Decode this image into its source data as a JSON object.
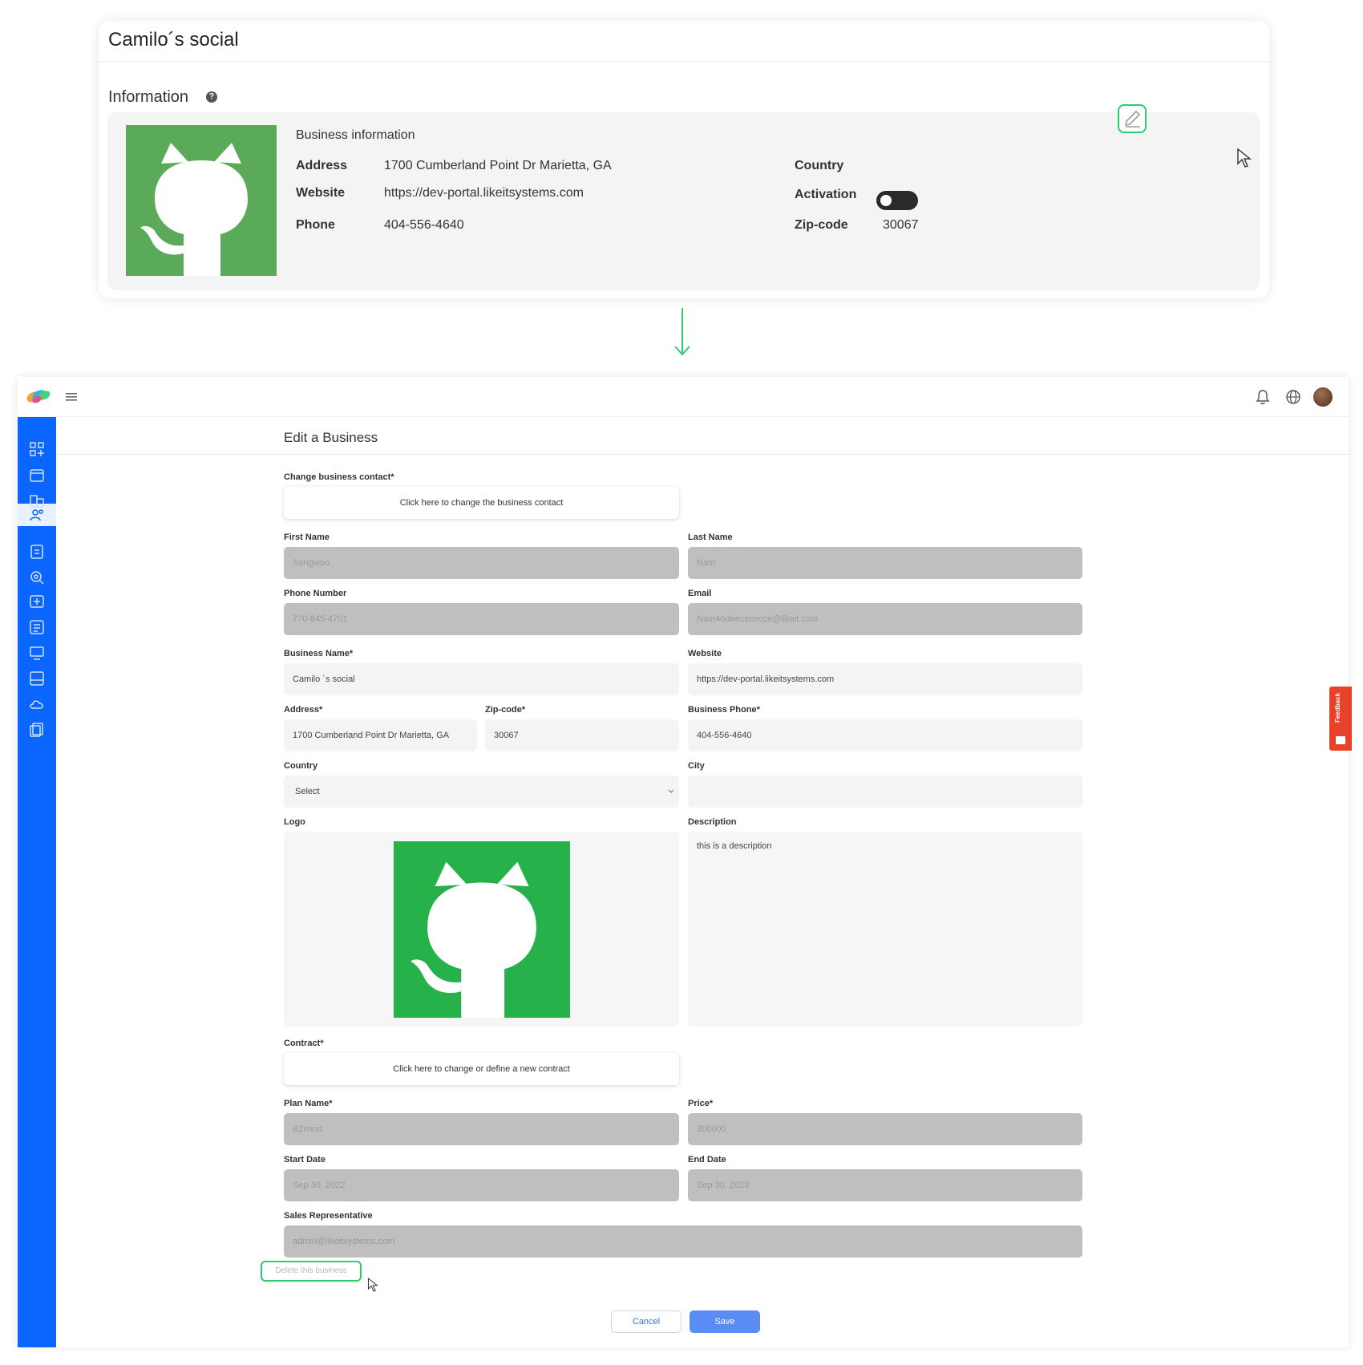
{
  "top_card": {
    "title": "Camilo´s social",
    "information_label": "Information",
    "help_glyph": "?",
    "business_info_title": "Business information",
    "fields": [
      {
        "label": "Address",
        "value": "1700 Cumberland Point Dr Marietta, GA"
      },
      {
        "label": "Website",
        "value": "https://dev-portal.likeitsystems.com"
      },
      {
        "label": "Phone",
        "value": "404-556-4640"
      }
    ],
    "right_fields": [
      {
        "label": "Country",
        "value": ""
      },
      {
        "label": "Activation",
        "value": ""
      },
      {
        "label": "Zip-code",
        "value": "30067"
      }
    ],
    "logo_icon": "github-octocat-icon",
    "edit_icon": "pencil-icon",
    "activation_on": false
  },
  "app": {
    "header_icons": [
      "menu-icon",
      "bell-icon",
      "globe-icon",
      "avatar"
    ],
    "sidebar_icons": [
      "dashboard-icon",
      "calendar-icon",
      "building-icon",
      "users-icon",
      "report-icon",
      "search-target-icon",
      "plus-box-icon",
      "list-icon",
      "monitor-icon",
      "image-icon",
      "cloud-icon",
      "docs-icon"
    ],
    "sidebar_active_index": 3,
    "page_title": "Edit a Business",
    "form": {
      "change_contact_label": "Change business contact*",
      "change_contact_button": "Click here to change the business contact",
      "first_name_label": "First Name",
      "first_name_value": "Sangwoo",
      "last_name_label": "Last Name",
      "last_name_value": "Nam",
      "phone_label": "Phone Number",
      "phone_value": "770-845-4701",
      "email_label": "Email",
      "email_value": "Nam46deecececce@likeit.com",
      "business_name_label": "Business Name*",
      "business_name_value": "Camilo ´s social",
      "website_label": "Website",
      "website_value": "https://dev-portal.likeitsystems.com",
      "address_label": "Address*",
      "address_value": "1700 Cumberland Point Dr Marietta, GA",
      "zip_label": "Zip-code*",
      "zip_value": "30067",
      "business_phone_label": "Business Phone*",
      "business_phone_value": "404-556-4640",
      "country_label": "Country",
      "country_value": "Select",
      "city_label": "City",
      "city_value": "",
      "logo_label": "Logo",
      "description_label": "Description",
      "description_value": "this is a description",
      "contract_label": "Contract*",
      "contract_button": "Click here to change or define a new contract",
      "plan_name_label": "Plan Name*",
      "plan_name_value": "B2mind",
      "price_label": "Price*",
      "price_value": "200000",
      "start_date_label": "Start Date",
      "start_date_value": "Sep 30, 2022",
      "end_date_label": "End Date",
      "end_date_value": "Sep 30, 2023",
      "sales_rep_label": "Sales Representative",
      "sales_rep_value": "admin@likeitsystems.com",
      "delete_label": "Delete this business",
      "cancel_label": "Cancel",
      "save_label": "Save"
    },
    "feedback_label": "Feedback"
  },
  "colors": {
    "sidebar": "#0a66ff",
    "logo_green_top": "#5aaa5a",
    "logo_green_form": "#27b14b",
    "highlight": "#2ecc71",
    "save": "#5b8cf4",
    "feedback": "#e8422a"
  }
}
